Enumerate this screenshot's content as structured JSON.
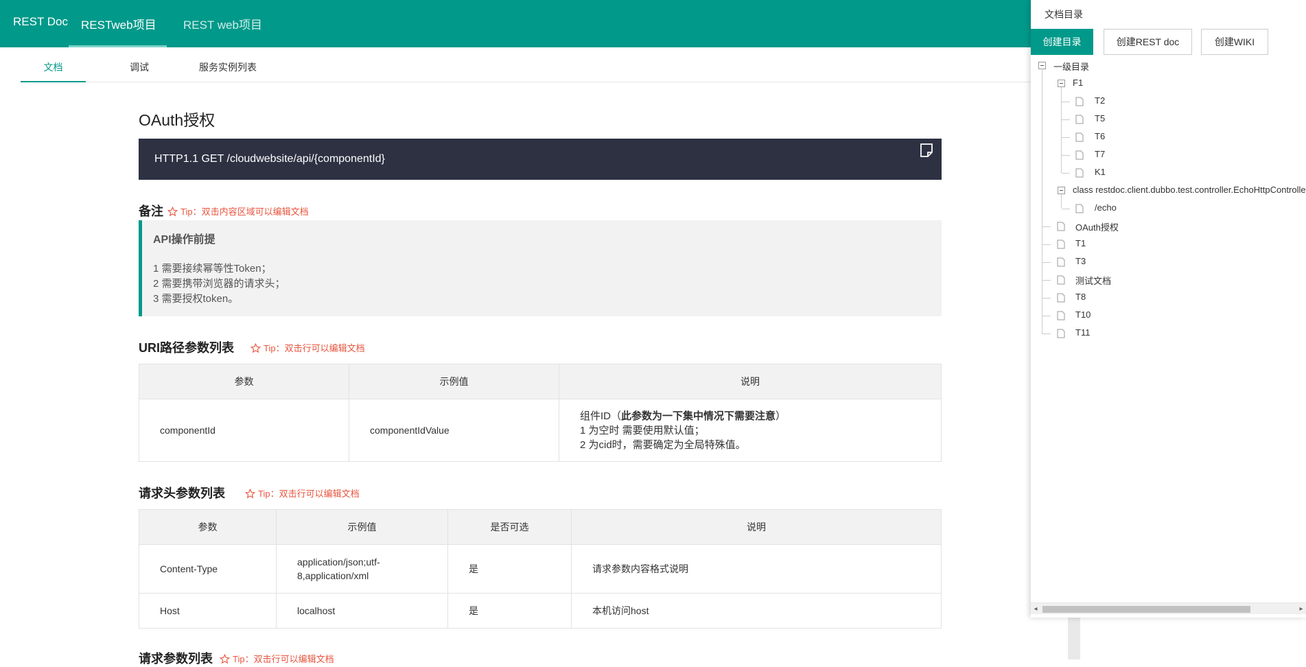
{
  "header": {
    "brand": "REST Doc",
    "nav": [
      "RESTweb项目",
      "REST web项目"
    ],
    "accent": "#00998a"
  },
  "tabs": [
    "文档",
    "调试",
    "服务实例列表"
  ],
  "doc": {
    "title": "OAuth授权",
    "endpoint": "HTTP1.1 GET /cloudwebsite/api/{componentId}",
    "copy_icon": "note-icon",
    "notes": {
      "title": "备注",
      "tip": "Tip：双击内容区域可以编辑文档",
      "heading": "API操作前提",
      "lines": [
        "1 需要接续幂等性Token；",
        "2 需要携带浏览器的请求头；",
        "3 需要授权token。"
      ]
    },
    "uri_params": {
      "title": "URI路径参数列表",
      "tip": "Tip：双击行可以编辑文档",
      "columns": [
        "参数",
        "示例值",
        "说明"
      ],
      "rows": [
        {
          "param": "componentId",
          "example": "componentIdValue",
          "desc_prefix": "组件ID（",
          "desc_bold": "此参数为一下集中情况下需要注意",
          "desc_suffix": "）",
          "desc_lines": [
            "1 为空时 需要使用默认值；",
            "2 为cid时，需要确定为全局特殊值。"
          ]
        }
      ]
    },
    "header_params": {
      "title": "请求头参数列表",
      "tip": "Tip：双击行可以编辑文档",
      "columns": [
        "参数",
        "示例值",
        "是否可选",
        "说明"
      ],
      "rows": [
        {
          "param": "Content-Type",
          "example": "application/json;utf-8,application/xml",
          "optional": "是",
          "desc": "请求参数内容格式说明"
        },
        {
          "param": "Host",
          "example": "localhost",
          "optional": "是",
          "desc": "本机访问host"
        }
      ]
    },
    "request_params": {
      "title": "请求参数列表",
      "tip": "Tip：双击行可以编辑文档"
    }
  },
  "panel": {
    "title": "文档目录",
    "buttons": [
      "创建目录",
      "创建REST doc",
      "创建WIKI"
    ],
    "tree": {
      "root": "一级目录",
      "f1": "F1",
      "f1_children": [
        "T2",
        "T5",
        "T6",
        "T7",
        "K1"
      ],
      "class_node": "class restdoc.client.dubbo.test.controller.EchoHttpController",
      "class_children": [
        "/echo"
      ],
      "root_children": [
        "OAuth授权",
        "T1",
        "T3",
        "测试文档",
        "T8",
        "T10",
        "T11"
      ]
    }
  }
}
